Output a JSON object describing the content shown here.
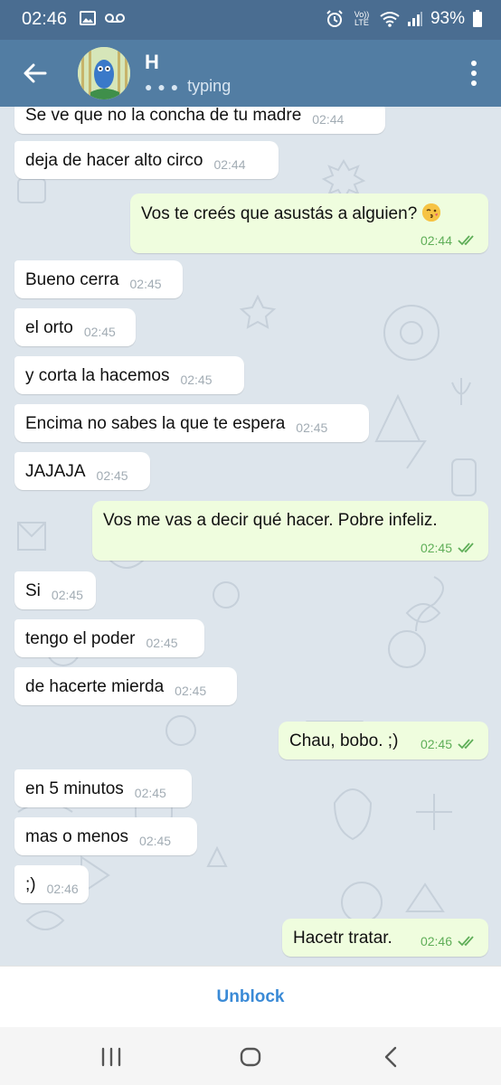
{
  "status_bar": {
    "time": "02:46",
    "battery": "93%",
    "volte": "Vo)) LTE",
    "icons": [
      "image-icon",
      "voicemail-icon",
      "alarm-icon",
      "volte-icon",
      "wifi-icon",
      "signal-icon",
      "battery-icon"
    ]
  },
  "header": {
    "name": "H",
    "status": "typing",
    "icons": [
      "back-arrow-icon",
      "more-vert-icon"
    ]
  },
  "messages": [
    {
      "dir": "in",
      "text": "Se ve que no la concha de tu madre",
      "time": "02:44"
    },
    {
      "dir": "in",
      "text": "deja de hacer alto circo",
      "time": "02:44"
    },
    {
      "dir": "out",
      "text": "Vos te creés que asustás a alguien?",
      "emoji": "kissing-face-emoji",
      "time": "02:44",
      "read": true
    },
    {
      "dir": "in",
      "text": "Bueno cerra",
      "time": "02:45"
    },
    {
      "dir": "in",
      "text": "el orto",
      "time": "02:45"
    },
    {
      "dir": "in",
      "text": "y corta la hacemos",
      "time": "02:45"
    },
    {
      "dir": "in",
      "text": "Encima no sabes la que te espera",
      "time": "02:45"
    },
    {
      "dir": "in",
      "text": "JAJAJA",
      "time": "02:45"
    },
    {
      "dir": "out",
      "text": "Vos me vas a decir qué hacer. Pobre infeliz.",
      "time": "02:45",
      "read": true
    },
    {
      "dir": "in",
      "text": "Si",
      "time": "02:45"
    },
    {
      "dir": "in",
      "text": "tengo el poder",
      "time": "02:45"
    },
    {
      "dir": "in",
      "text": "de hacerte mierda",
      "time": "02:45"
    },
    {
      "dir": "out",
      "text": "Chau, bobo. ;)",
      "time": "02:45",
      "read": true
    },
    {
      "dir": "in",
      "text": "en 5 minutos",
      "time": "02:45"
    },
    {
      "dir": "in",
      "text": "mas o menos",
      "time": "02:45"
    },
    {
      "dir": "in",
      "text": ";)",
      "time": "02:46"
    },
    {
      "dir": "out",
      "text": "Hacetr tratar.",
      "time": "02:46",
      "read": true
    }
  ],
  "unblock_label": "Unblock",
  "nav": [
    "recent-apps-icon",
    "home-icon",
    "back-icon"
  ],
  "colors": {
    "status_bar": "#4a6d91",
    "header": "#527da3",
    "chat_bg": "#dde5ec",
    "incoming_bubble": "#ffffff",
    "outgoing_bubble": "#effdde",
    "read_check": "#5fae58",
    "unblock": "#3a8ad6"
  }
}
